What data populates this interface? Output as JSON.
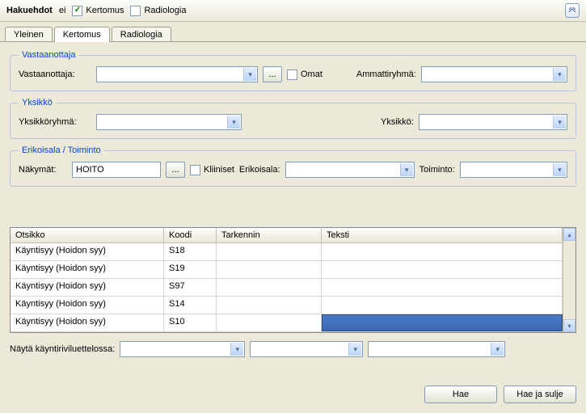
{
  "header": {
    "title": "Hakuehdot",
    "ei": "ei",
    "kertomus": "Kertomus",
    "radiologia": "Radiologia"
  },
  "tabs": {
    "yleinen": "Yleinen",
    "kertomus": "Kertomus",
    "radiologia": "Radiologia"
  },
  "vastaanottaja": {
    "legend": "Vastaanottaja",
    "label": "Vastaanottaja:",
    "omat": "Omat",
    "ammatti": "Ammattiryhmä:"
  },
  "yksikko": {
    "legend": "Yksikkö",
    "ryhma": "Yksikköryhmä:",
    "yksikko": "Yksikkö:"
  },
  "erikoisala": {
    "legend": "Erikoisala / Toiminto",
    "nakymat": "Näkymät:",
    "nakymat_val": "HOITO",
    "kliiniset": "Kliiniset",
    "erikoisala": "Erikoisala:",
    "toiminto": "Toiminto:"
  },
  "table": {
    "cols": {
      "otsikko": "Otsikko",
      "koodi": "Koodi",
      "tarkennin": "Tarkennin",
      "teksti": "Teksti"
    },
    "rows": [
      {
        "otsikko": "Käyntisyy (Hoidon syy)",
        "koodi": "S18",
        "tarkennin": "",
        "teksti": ""
      },
      {
        "otsikko": "Käyntisyy (Hoidon syy)",
        "koodi": "S19",
        "tarkennin": "",
        "teksti": ""
      },
      {
        "otsikko": "Käyntisyy (Hoidon syy)",
        "koodi": "S97",
        "tarkennin": "",
        "teksti": ""
      },
      {
        "otsikko": "Käyntisyy (Hoidon syy)",
        "koodi": "S14",
        "tarkennin": "",
        "teksti": ""
      },
      {
        "otsikko": "Käyntisyy (Hoidon syy)",
        "koodi": "S10",
        "tarkennin": "",
        "teksti": ""
      }
    ]
  },
  "bottom": {
    "label": "Näytä käyntiriviluettelossa:"
  },
  "buttons": {
    "hae": "Hae",
    "hae_sulje": "Hae ja sulje"
  },
  "dots": "..."
}
